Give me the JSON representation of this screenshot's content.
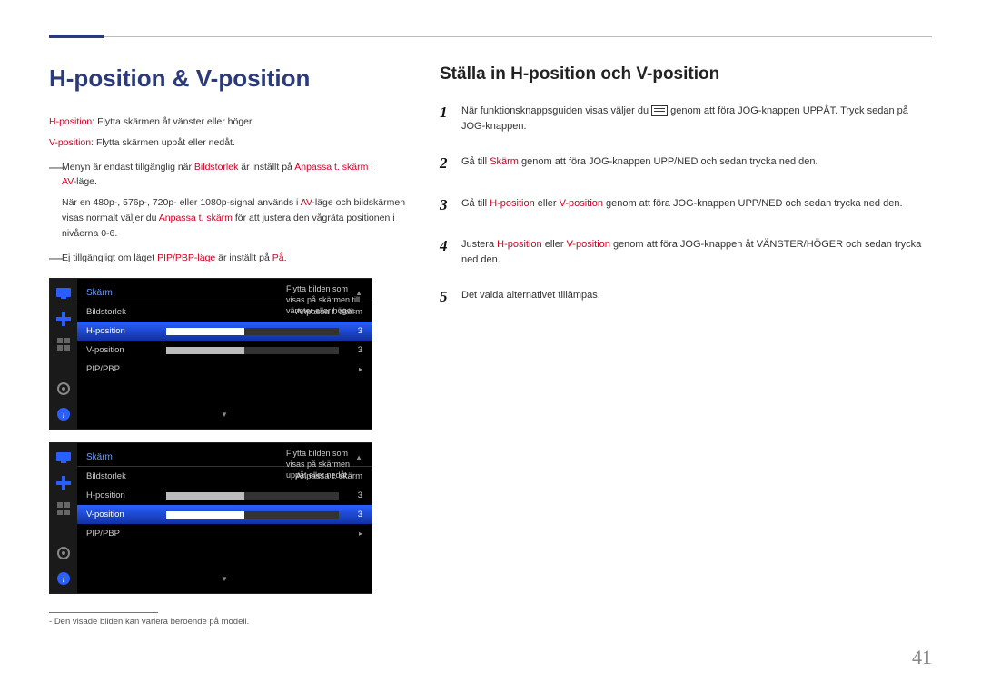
{
  "page_number": "41",
  "title": "H-position & V-position",
  "subtitle": "Ställa in H-position och V-position",
  "intro": {
    "h_label": "H-position",
    "h_text": ": Flytta skärmen åt vänster eller höger.",
    "v_label": "V-position",
    "v_text": ": Flytta skärmen uppåt eller nedåt."
  },
  "notes": {
    "n1_a": "Menyn är endast tillgänglig när ",
    "n1_b": "Bildstorlek",
    "n1_c": " är inställt på ",
    "n1_d": "Anpassa t. skärm",
    "n1_e": " i ",
    "n1_f": "AV",
    "n1_g": "-läge.",
    "n1_sub_a": "När en 480p-, 576p-, 720p- eller 1080p-signal används i ",
    "n1_sub_b": "AV",
    "n1_sub_c": "-läge och bildskärmen visas normalt väljer du ",
    "n1_sub_d": "Anpassa t. skärm",
    "n1_sub_e": " för att justera den vågräta positionen i nivåerna 0-6.",
    "n2_a": "Ej tillgängligt om läget ",
    "n2_b": "PIP/PBP-läge",
    "n2_c": " är inställt på ",
    "n2_d": "På",
    "n2_e": "."
  },
  "osd": {
    "header": "Skärm",
    "rows": {
      "bildstorlek": "Bildstorlek",
      "bildstorlek_val": "Anpassa t. skärm",
      "hpos": "H-position",
      "hpos_val": "3",
      "vpos": "V-position",
      "vpos_val": "3",
      "pip": "PIP/PBP"
    },
    "tooltip_h": "Flytta bilden som visas på skärmen till vänster eller höger.",
    "tooltip_v": "Flytta bilden som visas på skärmen uppåt eller nedåt."
  },
  "steps": {
    "s1_a": "När funktionsknappsguiden visas väljer du ",
    "s1_b": " genom att föra JOG-knappen UPPÅT. Tryck sedan på JOG-knappen.",
    "s2_a": "Gå till ",
    "s2_b": "Skärm",
    "s2_c": " genom att föra JOG-knappen UPP/NED och sedan trycka ned den.",
    "s3_a": "Gå till ",
    "s3_b": "H-position",
    "s3_c": " eller ",
    "s3_d": "V-position",
    "s3_e": " genom att föra JOG-knappen UPP/NED och sedan trycka ned den.",
    "s4_a": "Justera ",
    "s4_b": "H-position",
    "s4_c": " eller ",
    "s4_d": "V-position",
    "s4_e": " genom att föra JOG-knappen åt VÄNSTER/HÖGER och sedan trycka ned den.",
    "s5": "Det valda alternativet tillämpas."
  },
  "footnote": "Den visade bilden kan variera beroende på modell.",
  "nums": {
    "n1": "1",
    "n2": "2",
    "n3": "3",
    "n4": "4",
    "n5": "5"
  },
  "dash": "―",
  "dash2": "-"
}
